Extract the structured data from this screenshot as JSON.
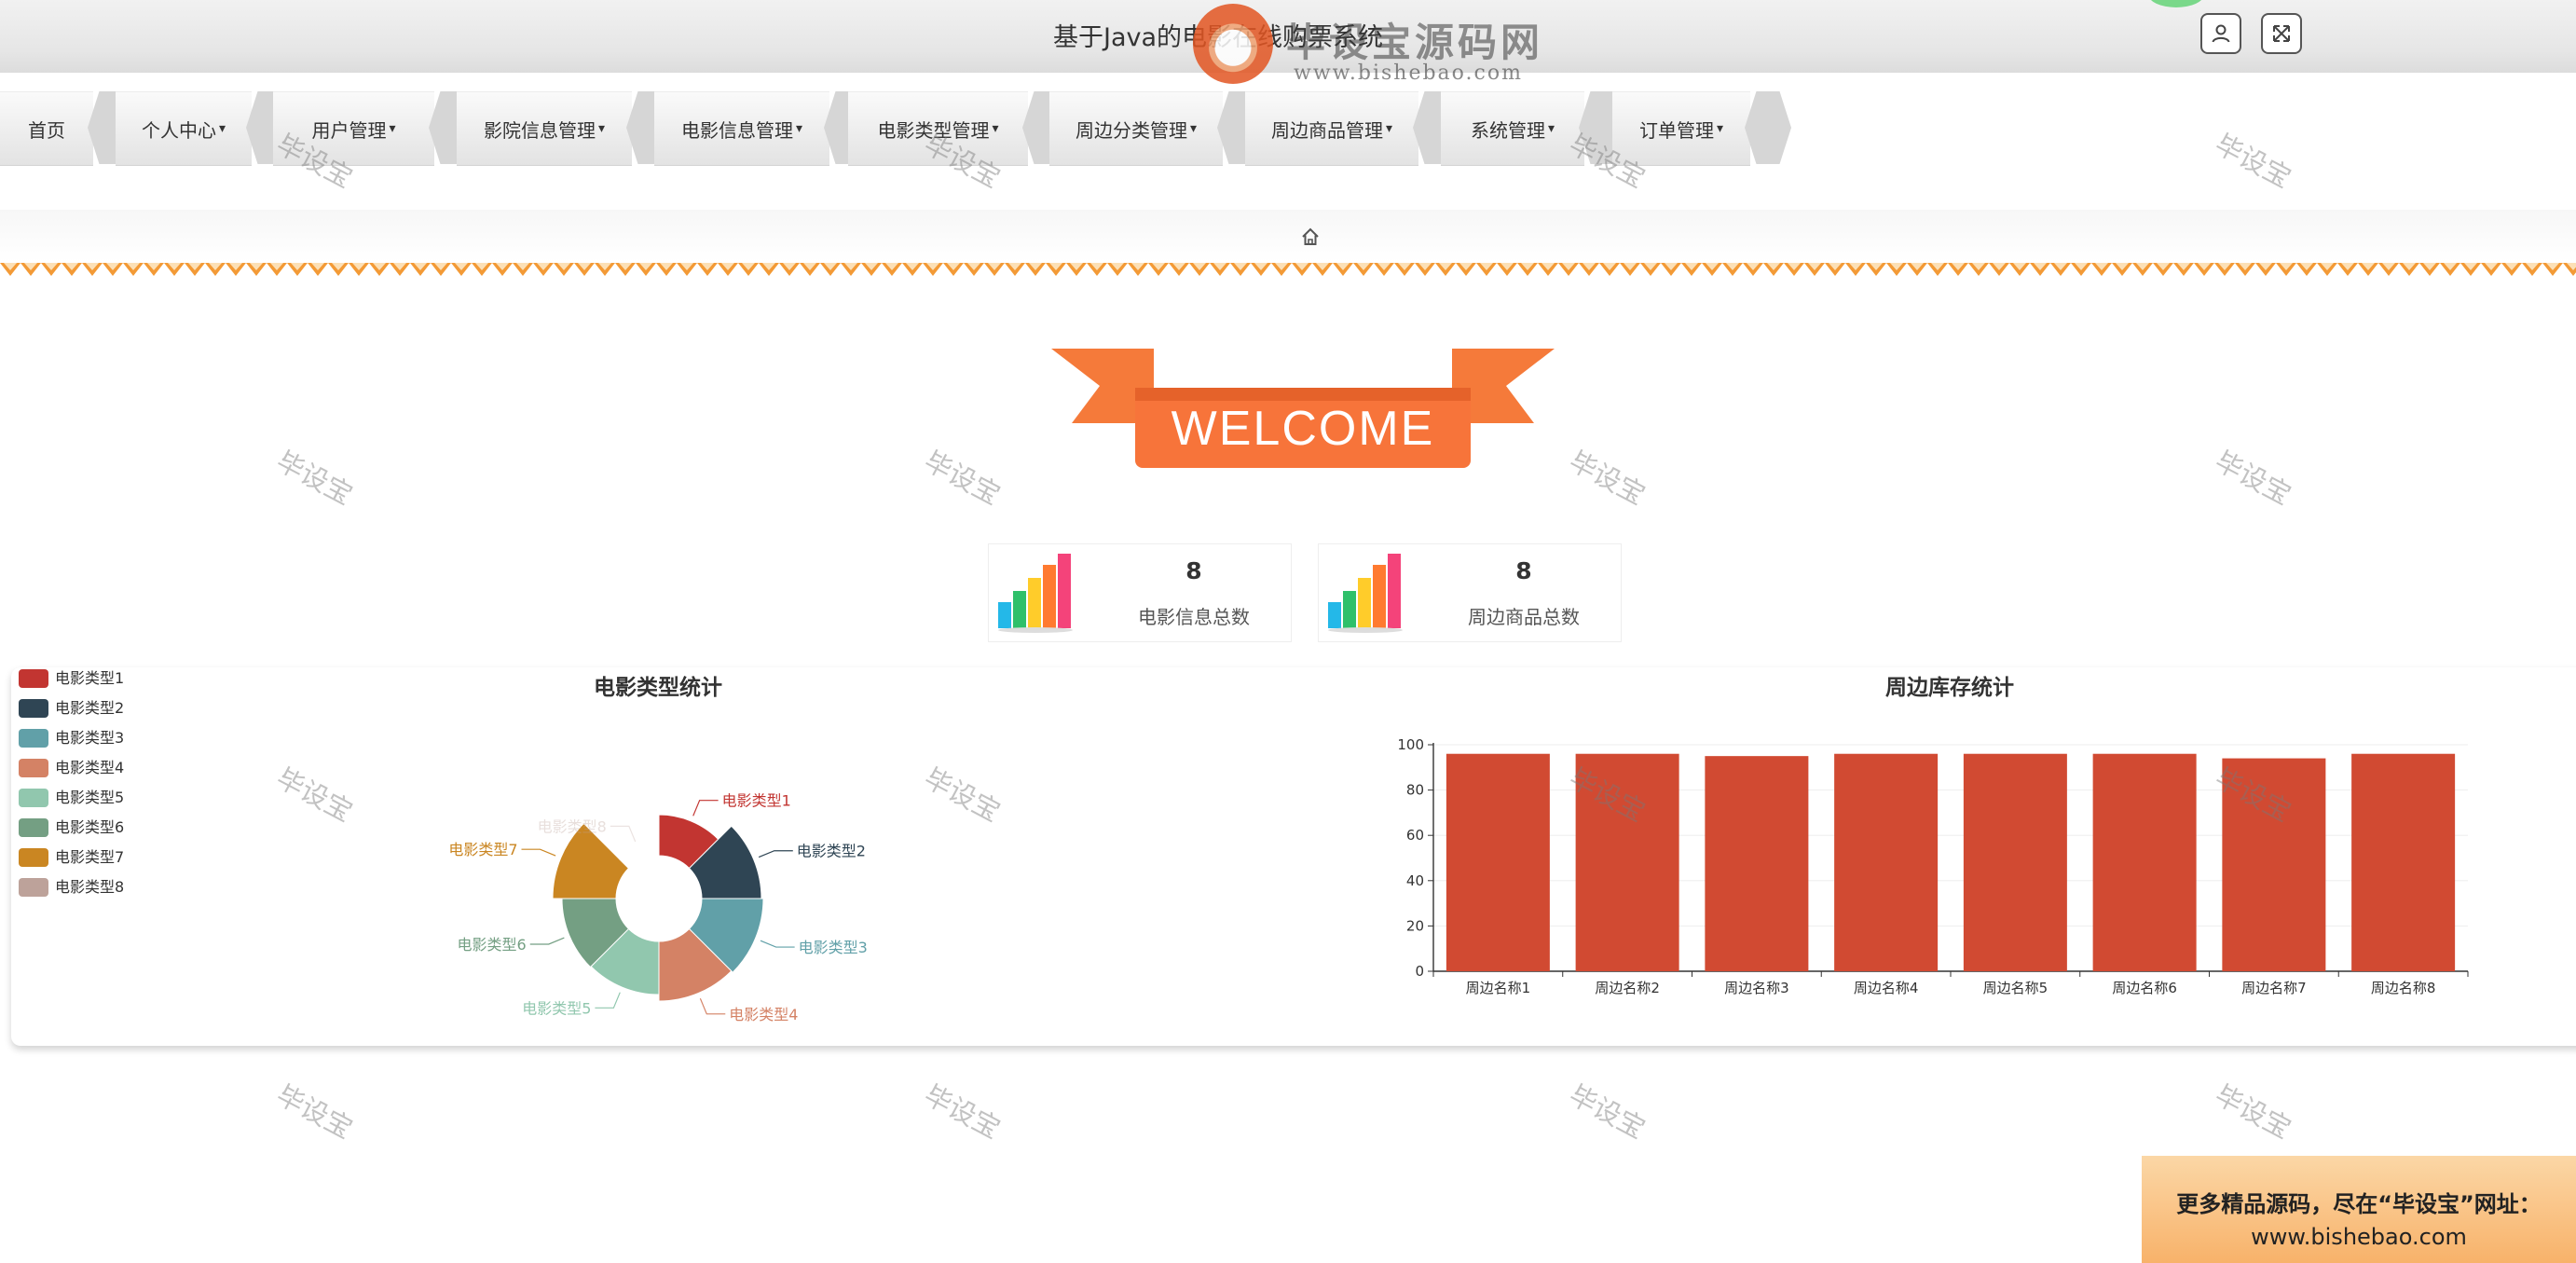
{
  "header": {
    "title": "基于Java的电影在线购票系统",
    "logo_text_cn": "毕设宝源码网",
    "logo_text_en": "www.bishebao.com"
  },
  "toolbar": {
    "icons": [
      "user-icon",
      "fullscreen-icon"
    ]
  },
  "nav": {
    "items": [
      {
        "label": "首页",
        "dropdown": false
      },
      {
        "label": "个人中心",
        "dropdown": true
      },
      {
        "label": "用户管理",
        "dropdown": true
      },
      {
        "label": "影院信息管理",
        "dropdown": true
      },
      {
        "label": "电影信息管理",
        "dropdown": true
      },
      {
        "label": "电影类型管理",
        "dropdown": true
      },
      {
        "label": "周边分类管理",
        "dropdown": true
      },
      {
        "label": "周边商品管理",
        "dropdown": true
      },
      {
        "label": "系统管理",
        "dropdown": true
      },
      {
        "label": "订单管理",
        "dropdown": true
      }
    ]
  },
  "breadcrumb": {
    "icon": "home-icon"
  },
  "welcome": {
    "text": "WELCOME"
  },
  "stats": [
    {
      "value": "8",
      "label": "电影信息总数",
      "icon": "bar-chart-icon"
    },
    {
      "value": "8",
      "label": "周边商品总数",
      "icon": "bar-chart-icon"
    }
  ],
  "watermark": {
    "text": "毕设宝"
  },
  "promo": {
    "line1": "更多精品源码，尽在“毕设宝”网址：",
    "line2": "www.bishebao.com"
  },
  "chart_data": [
    {
      "type": "pie",
      "title": "电影类型统计",
      "legend_position": "top-left",
      "categories": [
        "电影类型1",
        "电影类型2",
        "电影类型3",
        "电影类型4",
        "电影类型5",
        "电影类型6",
        "电影类型7",
        "电影类型8"
      ],
      "values": [
        1,
        1,
        1,
        1,
        1,
        1,
        1,
        1
      ],
      "colors": [
        "#c23531",
        "#2f4554",
        "#61a0a8",
        "#d48265",
        "#91c7ae",
        "#749f83",
        "#ca8622",
        "#bda29a"
      ],
      "style": "rose"
    },
    {
      "type": "bar",
      "title": "周边库存统计",
      "categories": [
        "周边名称1",
        "周边名称2",
        "周边名称3",
        "周边名称4",
        "周边名称5",
        "周边名称6",
        "周边名称7",
        "周边名称8"
      ],
      "values": [
        96,
        96,
        95,
        96,
        96,
        96,
        94,
        96
      ],
      "ylim": [
        0,
        100
      ],
      "yticks": [
        0,
        20,
        40,
        60,
        80,
        100
      ],
      "color": "#d14a32",
      "grid": true
    }
  ]
}
